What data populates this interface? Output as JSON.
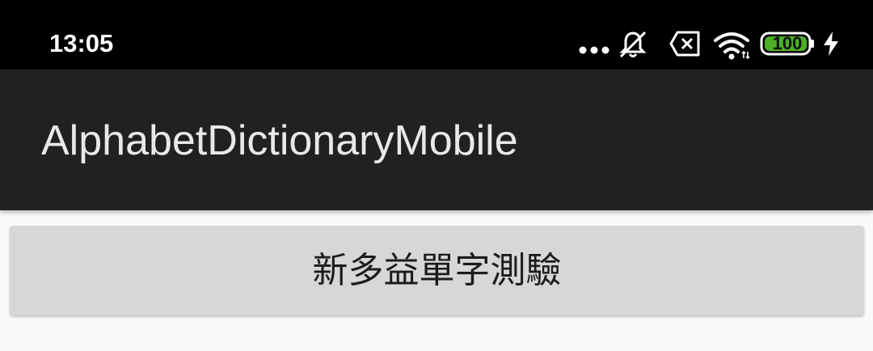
{
  "status_bar": {
    "time": "13:05",
    "battery_level": "100",
    "icons": [
      "more-dots-icon",
      "bell-muted-icon",
      "close-box-icon",
      "wifi-icon",
      "battery-icon",
      "charging-bolt-icon"
    ],
    "battery_color": "#4caf28"
  },
  "app_bar": {
    "title": "AlphabetDictionaryMobile",
    "background": "#212121"
  },
  "main": {
    "quiz_button_label": "新多益單字測驗"
  }
}
